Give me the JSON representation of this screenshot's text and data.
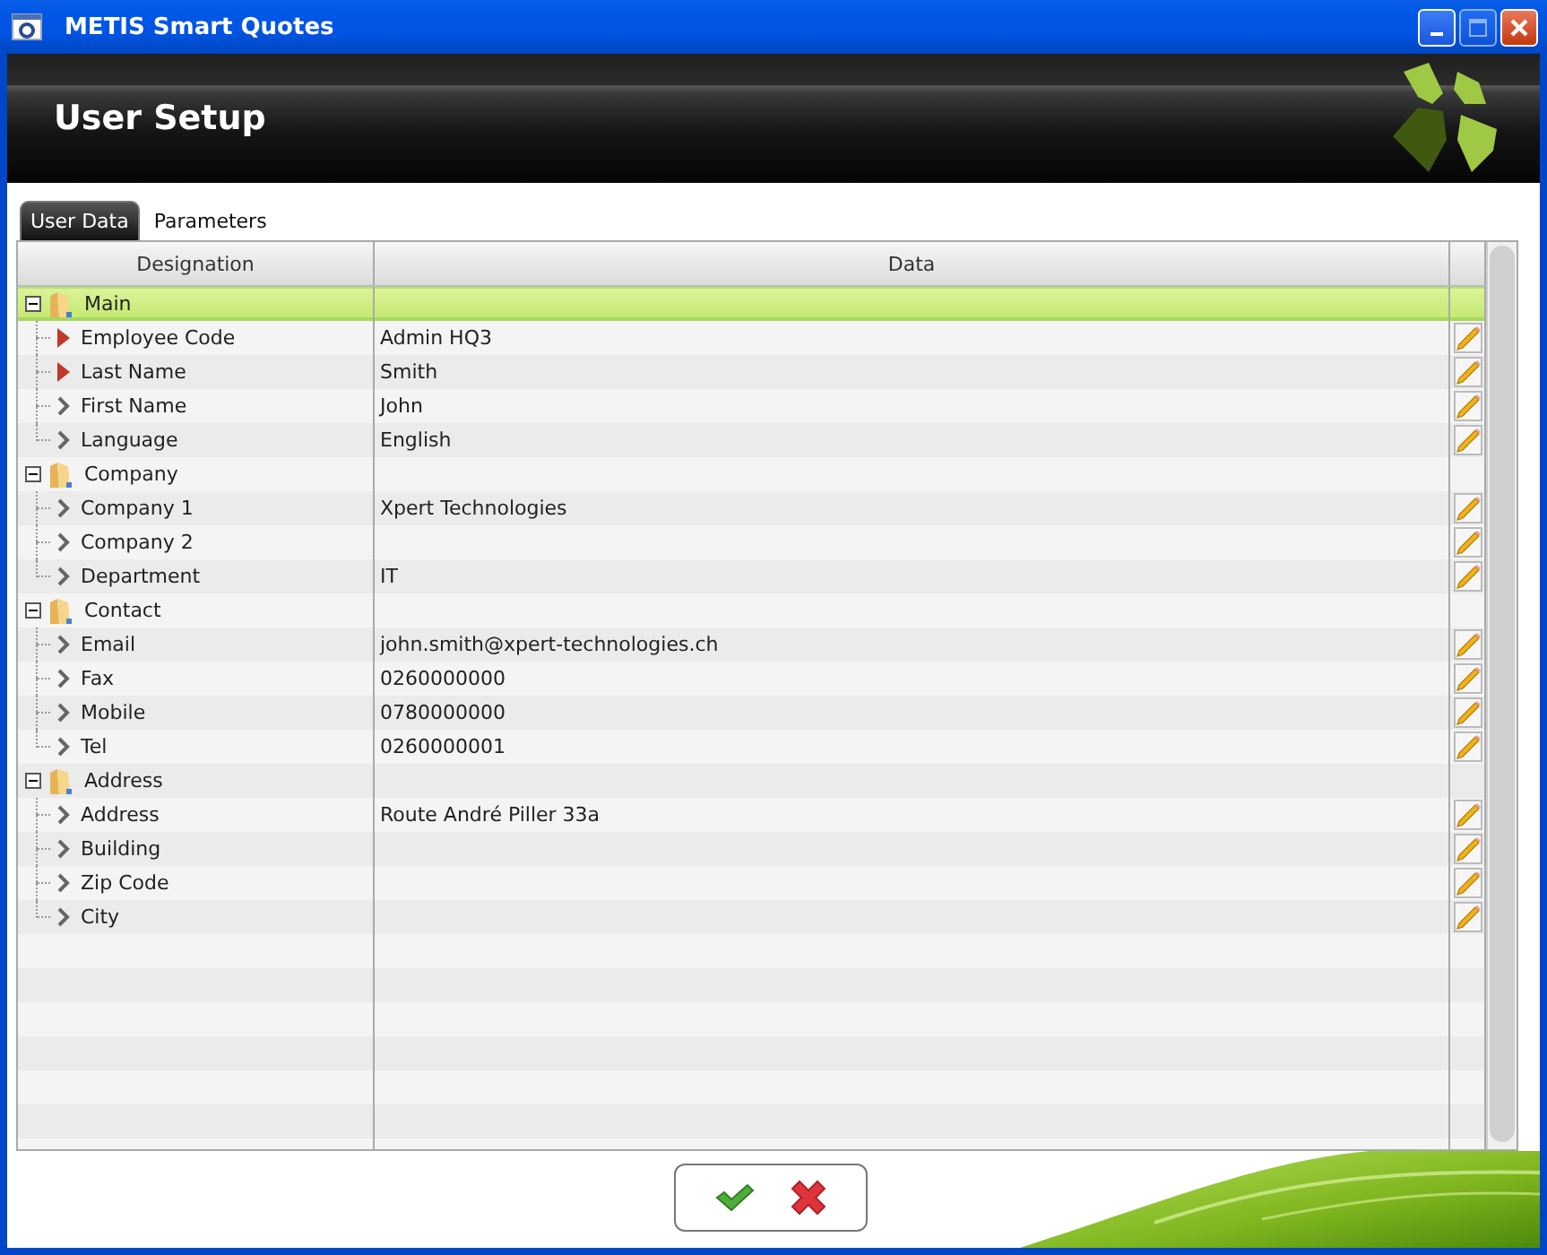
{
  "window": {
    "title": "METIS Smart Quotes"
  },
  "header": {
    "title": "User Setup"
  },
  "tabs": [
    {
      "label": "User Data",
      "selected": true
    },
    {
      "label": "Parameters",
      "selected": false
    }
  ],
  "table": {
    "columns": [
      "Designation",
      "Data"
    ],
    "groups": [
      {
        "label": "Main",
        "expanded": true,
        "selected": true,
        "children": [
          {
            "label": "Employee Code",
            "value": "Admin HQ3",
            "required": true,
            "editable": true,
            "selected": false
          },
          {
            "label": "Last Name",
            "value": "Smith",
            "required": true,
            "editable": true,
            "selected": false
          },
          {
            "label": "First Name",
            "value": "John",
            "required": false,
            "editable": true,
            "selected": false
          },
          {
            "label": "Language",
            "value": "English",
            "required": false,
            "editable": true,
            "selected": false
          }
        ]
      },
      {
        "label": "Company",
        "expanded": true,
        "selected": false,
        "children": [
          {
            "label": "Company 1",
            "value": "Xpert Technologies",
            "required": false,
            "editable": true,
            "selected": false
          },
          {
            "label": "Company 2",
            "required": false,
            "editable": true,
            "selected": false
          },
          {
            "label": "Department",
            "value": "IT",
            "required": false,
            "editable": true,
            "selected": false
          }
        ]
      },
      {
        "label": "Contact",
        "expanded": true,
        "selected": false,
        "children": [
          {
            "label": "Email",
            "value": "john.smith@xpert-technologies.ch",
            "required": false,
            "editable": true,
            "selected": false
          },
          {
            "label": "Fax",
            "value": "0260000000",
            "required": false,
            "editable": true,
            "selected": false
          },
          {
            "label": "Mobile",
            "value": "0780000000",
            "required": false,
            "editable": true,
            "selected": false
          },
          {
            "label": "Tel",
            "value": "0260000001",
            "required": false,
            "editable": true,
            "selected": false
          }
        ]
      },
      {
        "label": "Address",
        "expanded": true,
        "selected": false,
        "children": [
          {
            "label": "Address",
            "value": "Route André Piller 33a",
            "required": false,
            "editable": true,
            "selected": false
          },
          {
            "label": "Building",
            "required": false,
            "editable": true,
            "selected": false
          },
          {
            "label": "Zip Code",
            "required": false,
            "editable": true,
            "selected": false
          },
          {
            "label": "City",
            "required": false,
            "editable": true,
            "selected": false
          }
        ]
      }
    ]
  }
}
